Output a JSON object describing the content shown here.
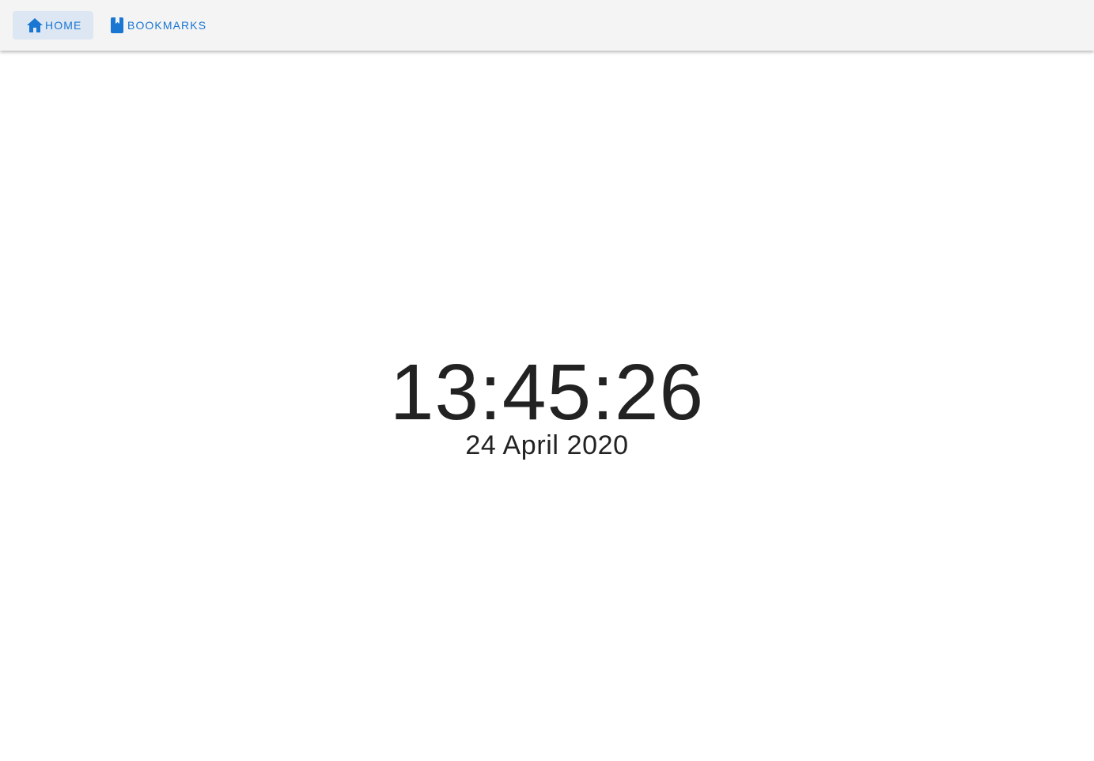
{
  "nav": {
    "home": {
      "label": "HOME",
      "icon": "home-icon",
      "active": true
    },
    "bookmarks": {
      "label": "BOOKMARKS",
      "icon": "bookmark-icon"
    }
  },
  "clock": {
    "time": "13:45:26",
    "date": "24 April 2020"
  },
  "colors": {
    "accent": "#1976d2",
    "active_tab_bg": "#dde7f3",
    "toolbar_bg": "#f4f4f4",
    "text": "#222222"
  }
}
